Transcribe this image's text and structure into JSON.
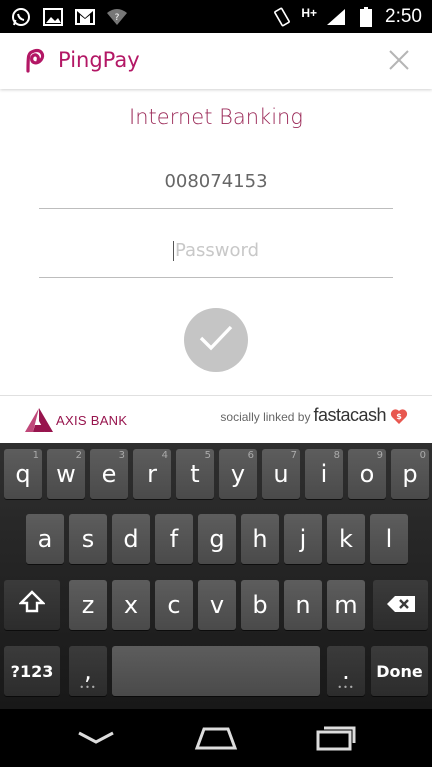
{
  "status_bar": {
    "network": "H+",
    "time": "2:50",
    "icons": [
      "whatsapp-icon",
      "image-icon",
      "gmail-icon",
      "wifi-question-icon",
      "rotate-icon",
      "signal-icon",
      "battery-icon"
    ]
  },
  "app": {
    "brand": "PingPay",
    "brand_color": "#b31765",
    "heading": "Internet Banking",
    "user_id": "008074153",
    "password_placeholder": "Password",
    "submit_icon": "checkmark-icon",
    "close_icon": "close-icon"
  },
  "footer": {
    "bank_name": "AXIS BANK",
    "powered_by": "socially linked by",
    "partner": "fastacash",
    "bank_color": "#97144d"
  },
  "keyboard": {
    "row1": [
      {
        "k": "q",
        "h": "1"
      },
      {
        "k": "w",
        "h": "2"
      },
      {
        "k": "e",
        "h": "3"
      },
      {
        "k": "r",
        "h": "4"
      },
      {
        "k": "t",
        "h": "5"
      },
      {
        "k": "y",
        "h": "6"
      },
      {
        "k": "u",
        "h": "7"
      },
      {
        "k": "i",
        "h": "8"
      },
      {
        "k": "o",
        "h": "9"
      },
      {
        "k": "p",
        "h": "0"
      }
    ],
    "row2": [
      "a",
      "s",
      "d",
      "f",
      "g",
      "h",
      "j",
      "k",
      "l"
    ],
    "row3": [
      "z",
      "x",
      "c",
      "v",
      "b",
      "n",
      "m"
    ],
    "symbols_label": "?123",
    "comma": ",",
    "period": ".",
    "done_label": "Done"
  },
  "nav": {
    "icons": [
      "back-icon",
      "home-icon",
      "recents-icon"
    ]
  }
}
